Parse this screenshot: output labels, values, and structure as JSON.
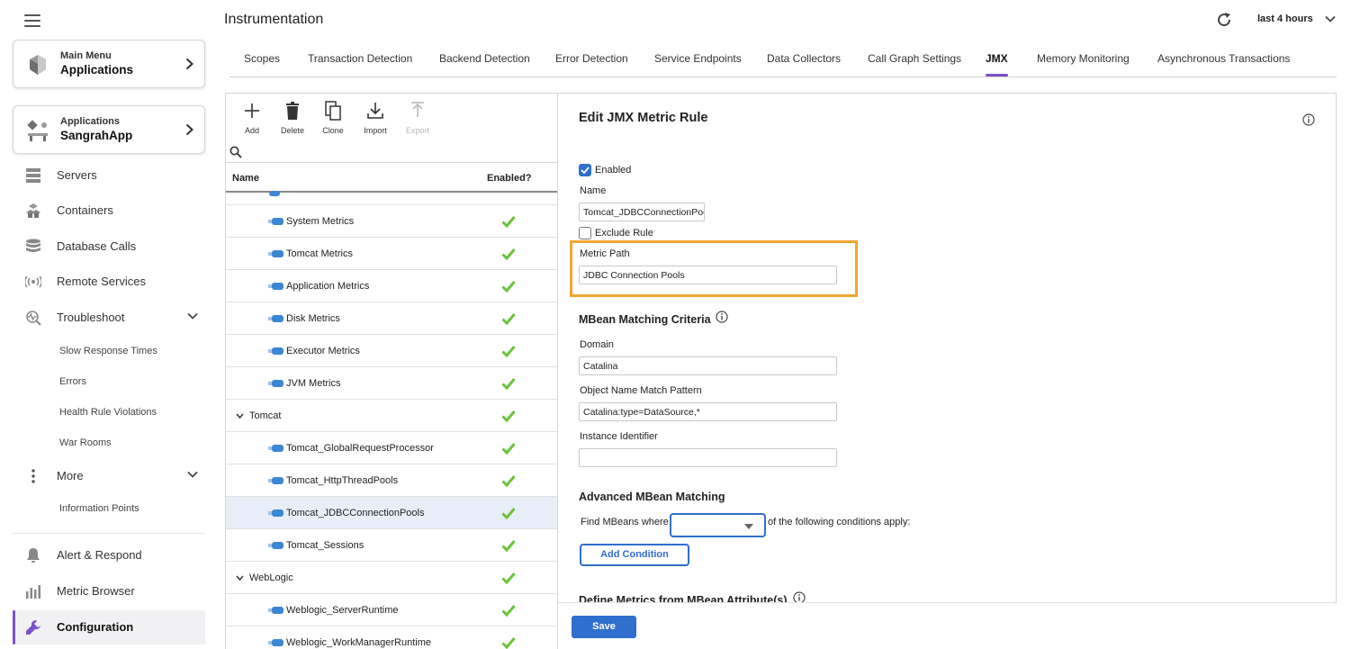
{
  "header": {
    "title": "Instrumentation",
    "time_range": "last 4 hours"
  },
  "tabs": [
    {
      "label": "Scopes"
    },
    {
      "label": "Transaction Detection"
    },
    {
      "label": "Backend Detection"
    },
    {
      "label": "Error Detection"
    },
    {
      "label": "Service Endpoints"
    },
    {
      "label": "Data Collectors"
    },
    {
      "label": "Call Graph Settings"
    },
    {
      "label": "JMX",
      "active": true
    },
    {
      "label": "Memory Monitoring"
    },
    {
      "label": "Asynchronous Transactions"
    }
  ],
  "sidebar": {
    "main_menu": {
      "small": "Main Menu",
      "big": "Applications"
    },
    "app_menu": {
      "small": "Applications",
      "big": "SangrahApp"
    },
    "items": [
      {
        "label": "Servers",
        "icon": "servers-icon"
      },
      {
        "label": "Containers",
        "icon": "containers-icon"
      },
      {
        "label": "Database Calls",
        "icon": "database-icon"
      },
      {
        "label": "Remote Services",
        "icon": "remote-services-icon"
      },
      {
        "label": "Troubleshoot",
        "icon": "troubleshoot-icon"
      },
      {
        "label": "More",
        "icon": "more-icon"
      },
      {
        "label": "Alert & Respond",
        "icon": "bell-icon"
      },
      {
        "label": "Metric Browser",
        "icon": "bar-chart-icon"
      },
      {
        "label": "Configuration",
        "icon": "wrench-icon",
        "active": true
      }
    ],
    "troubleshoot_sub": [
      "Slow Response Times",
      "Errors",
      "Health Rule Violations",
      "War Rooms"
    ],
    "more_sub": [
      "Information Points"
    ]
  },
  "toolbar": {
    "add": "Add",
    "delete": "Delete",
    "clone": "Clone",
    "import": "Import",
    "export": "Export"
  },
  "rules": {
    "search_placeholder": "",
    "columns": {
      "name": "Name",
      "enabled": "Enabled?"
    },
    "rows": [
      {
        "label": "System Metrics",
        "type": "leaf",
        "enabled": true
      },
      {
        "label": "Tomcat Metrics",
        "type": "leaf",
        "enabled": true
      },
      {
        "label": "Application Metrics",
        "type": "leaf",
        "enabled": true
      },
      {
        "label": "Disk Metrics",
        "type": "leaf",
        "enabled": true
      },
      {
        "label": "Executor Metrics",
        "type": "leaf",
        "enabled": true
      },
      {
        "label": "JVM Metrics",
        "type": "leaf",
        "enabled": true
      },
      {
        "label": "Tomcat",
        "type": "group",
        "enabled": true
      },
      {
        "label": "Tomcat_GlobalRequestProcessor",
        "type": "leaf",
        "enabled": true
      },
      {
        "label": "Tomcat_HttpThreadPools",
        "type": "leaf",
        "enabled": true
      },
      {
        "label": "Tomcat_JDBCConnectionPools",
        "type": "leaf",
        "enabled": true,
        "selected": true
      },
      {
        "label": "Tomcat_Sessions",
        "type": "leaf",
        "enabled": true
      },
      {
        "label": "WebLogic",
        "type": "group",
        "enabled": true
      },
      {
        "label": "Weblogic_ServerRuntime",
        "type": "leaf",
        "enabled": true
      },
      {
        "label": "Weblogic_WorkManagerRuntime",
        "type": "leaf",
        "enabled": true
      }
    ]
  },
  "edit": {
    "title": "Edit JMX Metric Rule",
    "enabled_label": "Enabled",
    "enabled": true,
    "name_label": "Name",
    "name_value": "Tomcat_JDBCConnectionPools",
    "exclude_label": "Exclude Rule",
    "exclude": false,
    "metric_path_label": "Metric Path",
    "metric_path_value": "JDBC Connection Pools",
    "mbean_section": "MBean Matching Criteria",
    "domain_label": "Domain",
    "domain_value": "Catalina",
    "object_label": "Object Name Match Pattern",
    "object_value": "Catalina:type=DataSource,*",
    "instance_label": "Instance Identifier",
    "instance_value": "",
    "advanced_section": "Advanced MBean Matching",
    "find_prefix": "Find MBeans where",
    "find_select_value": "",
    "find_suffix": "of the following conditions apply:",
    "add_condition": "Add Condition",
    "define_section": "Define Metrics from MBean Attribute(s)"
  },
  "footer": {
    "save": "Save"
  },
  "colors": {
    "accent": "#7b52c7",
    "primary": "#2f6fcd",
    "highlight": "#f0a732",
    "check": "#6ac33a"
  }
}
